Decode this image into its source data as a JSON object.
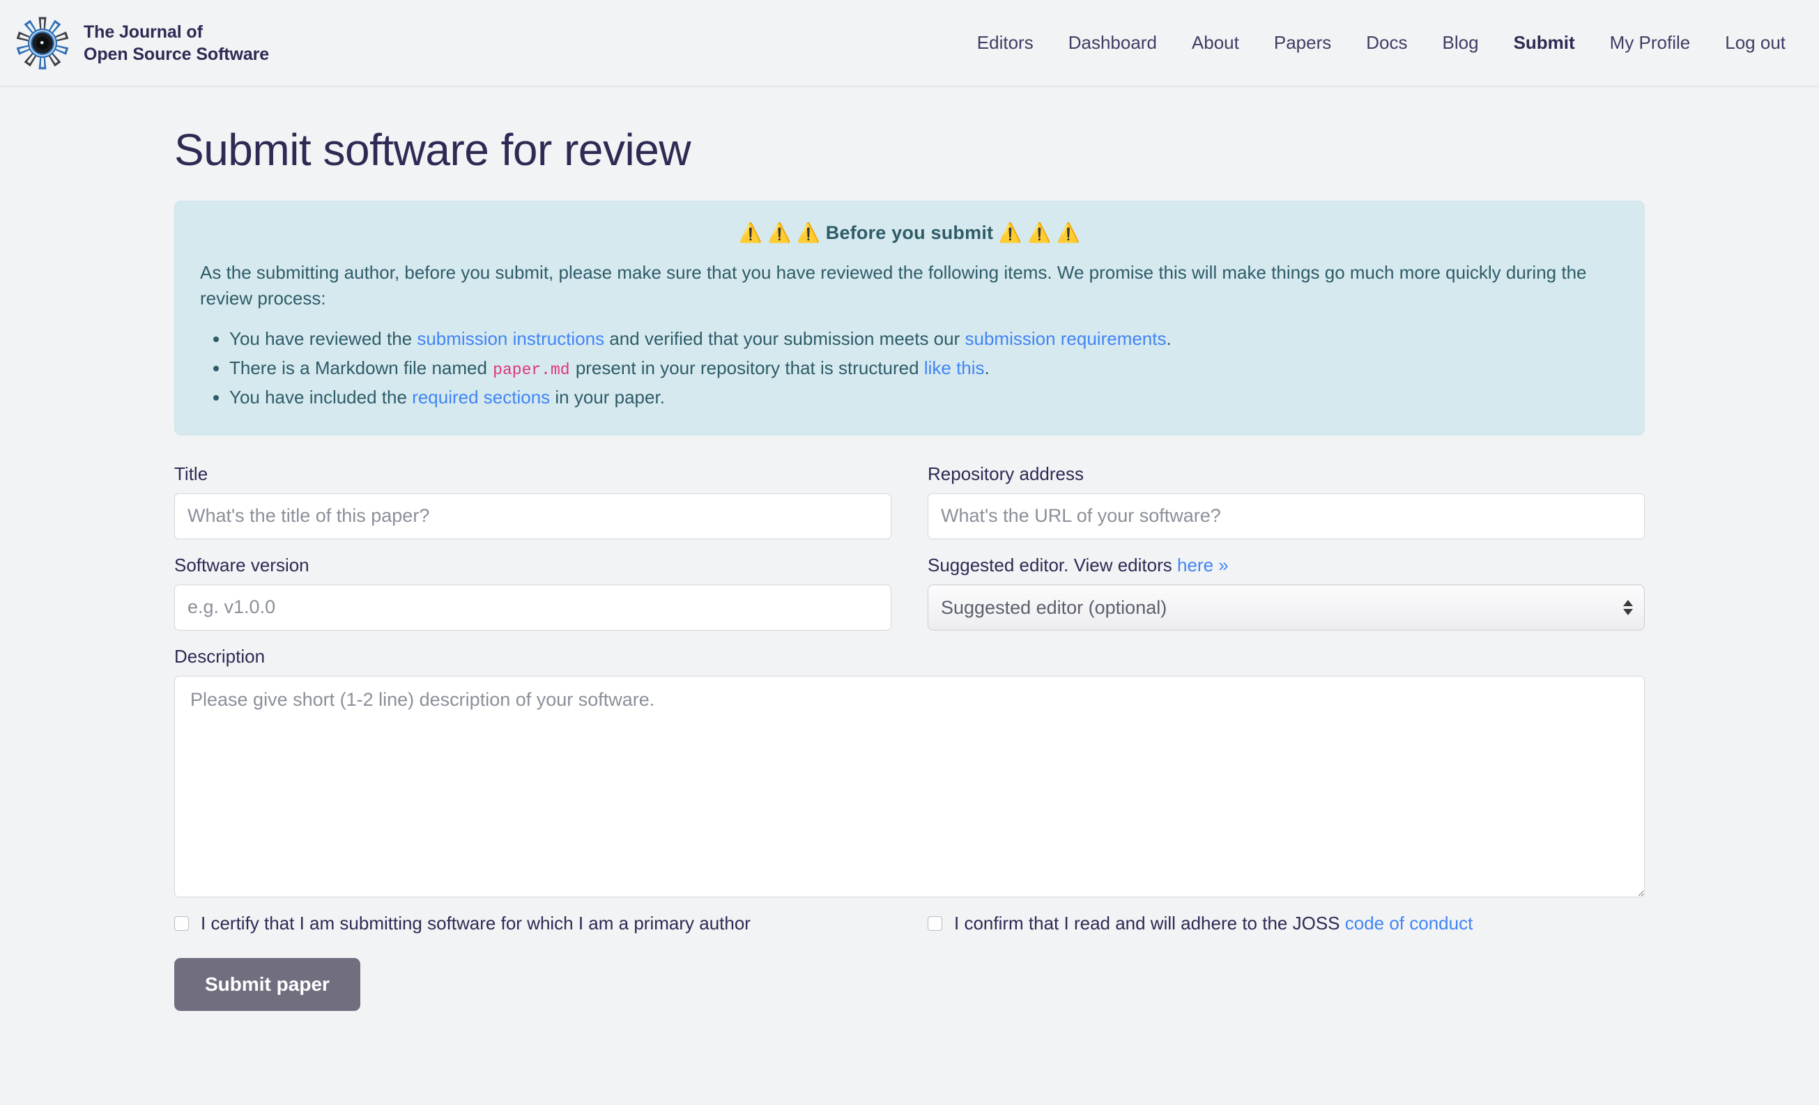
{
  "header": {
    "brand": {
      "logo_icon": "joss-gear-logo-icon",
      "line1": "The Journal of",
      "line2": "Open Source Software"
    },
    "nav": [
      {
        "label": "Editors",
        "active": false
      },
      {
        "label": "Dashboard",
        "active": false
      },
      {
        "label": "About",
        "active": false
      },
      {
        "label": "Papers",
        "active": false
      },
      {
        "label": "Docs",
        "active": false
      },
      {
        "label": "Blog",
        "active": false
      },
      {
        "label": "Submit",
        "active": true
      },
      {
        "label": "My Profile",
        "active": false
      },
      {
        "label": "Log out",
        "active": false
      }
    ]
  },
  "main": {
    "page_title": "Submit software for review",
    "alert": {
      "warning_icon": "warning-triangle-icon",
      "heading_icons_left": "⚠️ ⚠️ ⚠️",
      "heading_text": "Before you submit",
      "heading_icons_right": "⚠️ ⚠️ ⚠️",
      "body": "As the submitting author, before you submit, please make sure that you have reviewed the following items. We promise this will make things go much more quickly during the review process:",
      "items": [
        {
          "part1": "You have reviewed the ",
          "link1": "submission instructions",
          "part2": " and verified that your submission meets our ",
          "link2": "submission requirements",
          "part3": "."
        },
        {
          "part1": "There is a Markdown file named ",
          "code": "paper.md",
          "part2": " present in your repository that is structured ",
          "link2": "like this",
          "part3": "."
        },
        {
          "part1": "You have included the ",
          "link1": "required sections",
          "part2": " in your paper.",
          "part3": ""
        }
      ]
    },
    "form": {
      "title_field": {
        "label": "Title",
        "placeholder": "What's the title of this paper?",
        "value": ""
      },
      "repository_field": {
        "label": "Repository address",
        "placeholder": "What's the URL of your software?",
        "value": ""
      },
      "version_field": {
        "label": "Software version",
        "placeholder": "e.g. v1.0.0",
        "value": ""
      },
      "editor_field": {
        "label_text": "Suggested editor. View editors ",
        "label_link": "here »",
        "selected_option": "Suggested editor (optional)",
        "options": [
          "Suggested editor (optional)"
        ]
      },
      "description_field": {
        "label": "Description",
        "placeholder": "Please give short (1-2 line) description of your software.",
        "value": ""
      },
      "certify_checkbox": {
        "label": "I certify that I am submitting software for which I am a primary author",
        "checked": false
      },
      "conduct_checkbox": {
        "label_text": "I confirm that I read and will adhere to the JOSS ",
        "label_link": "code of conduct",
        "checked": false
      },
      "submit_button": "Submit paper"
    }
  },
  "colors": {
    "page_bg": "#f2f3f5",
    "brand_navy": "#2d2a54",
    "alert_bg": "#d6e9ef",
    "alert_text": "#2e5c68",
    "link_blue": "#4285f4",
    "code_pink": "#e0367a",
    "button_gray": "#716e80"
  }
}
